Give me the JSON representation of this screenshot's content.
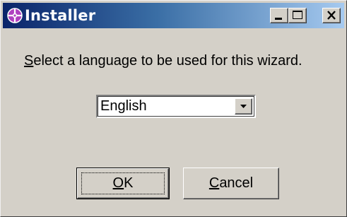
{
  "window": {
    "title": "Installer",
    "icon": "installer-app-icon",
    "controls": {
      "minimize_icon": "minimize-icon",
      "maximize_icon": "maximize-icon",
      "close_icon": "close-icon"
    }
  },
  "prompt": {
    "mnemonic": "S",
    "text": "elect a language to be used for this wizard."
  },
  "language_select": {
    "value": "English",
    "icon": "chevron-down-icon"
  },
  "buttons": {
    "ok": {
      "mnemonic": "O",
      "rest": "K"
    },
    "cancel": {
      "mnemonic": "C",
      "rest": "ancel"
    }
  },
  "colors": {
    "titlebar_start": "#0a246a",
    "titlebar_end": "#a6caf0",
    "face": "#d4d0c8",
    "icon_accent": "#b040c0"
  }
}
